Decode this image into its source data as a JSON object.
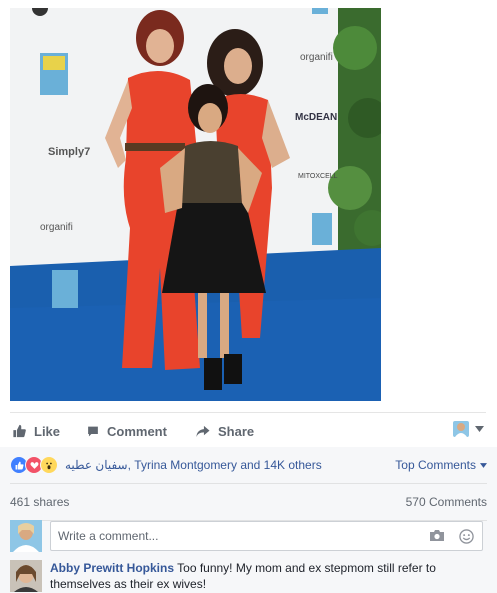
{
  "actions": {
    "like": "Like",
    "comment": "Comment",
    "share": "Share"
  },
  "reactions": {
    "names": "سفيان عطيه, Tyrina Montgomery and 14K others",
    "icons": [
      "like-reaction-icon",
      "love-reaction-icon",
      "wow-reaction-icon"
    ],
    "colors": {
      "like": "#4080ff",
      "love": "#f25268",
      "wow": "#ffd85c"
    }
  },
  "sort": {
    "label": "Top Comments"
  },
  "stats": {
    "shares": "461 shares",
    "comments": "570 Comments"
  },
  "composer": {
    "placeholder": "Write a comment..."
  },
  "comment": {
    "author": "Abby Prewitt Hopkins",
    "text": "Too funny! My mom and ex stepmom still refer to themselves as their ex wives!"
  },
  "photo": {
    "backdrop_logos": [
      "organifi",
      "Simply7",
      "McDEAN",
      "MITOXCELL",
      "organifi"
    ],
    "colors": {
      "carpet": "#1a5fae",
      "dress": "#e8442c",
      "backdrop": "#f2f3f4"
    }
  },
  "theme": {
    "link": "#365899",
    "muted": "#606770",
    "panel": "#f6f7f9"
  }
}
